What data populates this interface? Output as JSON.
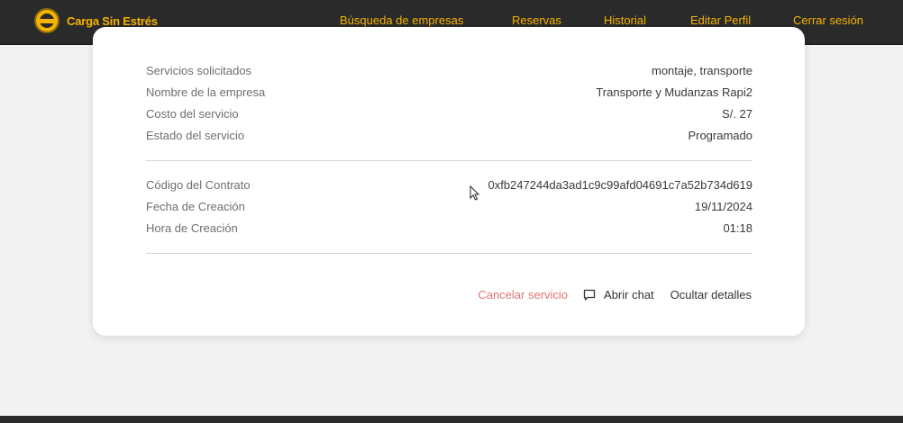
{
  "header": {
    "brand": "Carga Sin Estrés",
    "nav": [
      "Búsqueda de empresas",
      "Reservas",
      "Historial",
      "Editar Perfil",
      "Cerrar sesión"
    ],
    "brand_color": "#f5b400",
    "bg_color": "#2a2a2a"
  },
  "details": {
    "service": [
      {
        "label": "Servicios solicitados",
        "value": "montaje, transporte"
      },
      {
        "label": "Nombre de la empresa",
        "value": "Transporte y Mudanzas Rapi2"
      },
      {
        "label": "Costo del servicio",
        "value": "S/. 27"
      },
      {
        "label": "Estado del servicio",
        "value": "Programado"
      }
    ],
    "contract": [
      {
        "label": "Código del Contrato",
        "value": "0xfb247244da3ad1c9c99afd04691c7a52b734d619"
      },
      {
        "label": "Fecha de Creación",
        "value": "19/11/2024"
      },
      {
        "label": "Hora de Creación",
        "value": "01:18"
      }
    ]
  },
  "actions": {
    "cancel": "Cancelar servicio",
    "chat": "Abrir chat",
    "hide": "Ocultar detalles"
  },
  "icons": {
    "chat": "chat-bubble-icon",
    "logo": "truck-logo-icon",
    "cursor": "mouse-pointer-icon"
  },
  "colors": {
    "cancel": "#e57373",
    "accent": "#f5b400"
  }
}
